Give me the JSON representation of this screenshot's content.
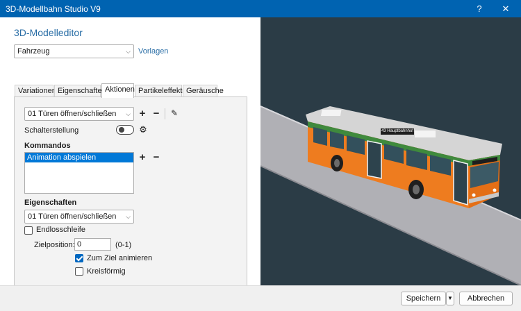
{
  "window": {
    "title": "3D-Modellbahn Studio V9",
    "help_glyph": "?",
    "close_glyph": "✕"
  },
  "editor": {
    "heading": "3D-Modelleditor",
    "type_select": "Fahrzeug",
    "templates_link": "Vorlagen"
  },
  "tabs": [
    {
      "label": "Variationen",
      "active": false
    },
    {
      "label": "Eigenschaften",
      "active": false
    },
    {
      "label": "Aktionen",
      "active": true
    },
    {
      "label": "Partikeleffekte",
      "active": false
    },
    {
      "label": "Geräusche",
      "active": false
    }
  ],
  "actions": {
    "action_select": "01 Türen öffnen/schließen",
    "add_glyph": "+",
    "remove_glyph": "−",
    "edit_glyph": "✎",
    "switch_label": "Schalterstellung",
    "switch_on": false,
    "commands_heading": "Kommandos",
    "commands": [
      "Animation abspielen"
    ],
    "properties_heading": "Eigenschaften",
    "property_select": "01 Türen öffnen/schließen",
    "loop_label": "Endlosschleife",
    "loop_checked": false,
    "target_label": "Zielposition:",
    "target_value": "0",
    "target_range": "(0-1)",
    "animate_label": "Zum Ziel animieren",
    "animate_checked": true,
    "circular_label": "Kreisförmig",
    "circular_checked": false
  },
  "footer": {
    "save_label": "Speichern",
    "cancel_label": "Abbrechen"
  },
  "bus": {
    "destination": "43 Hauptbahnhof",
    "colors": {
      "body": "#ee7c1f",
      "stripe": "#3f8a3d",
      "roof": "#d5d5d5",
      "window": "#33505c"
    }
  }
}
